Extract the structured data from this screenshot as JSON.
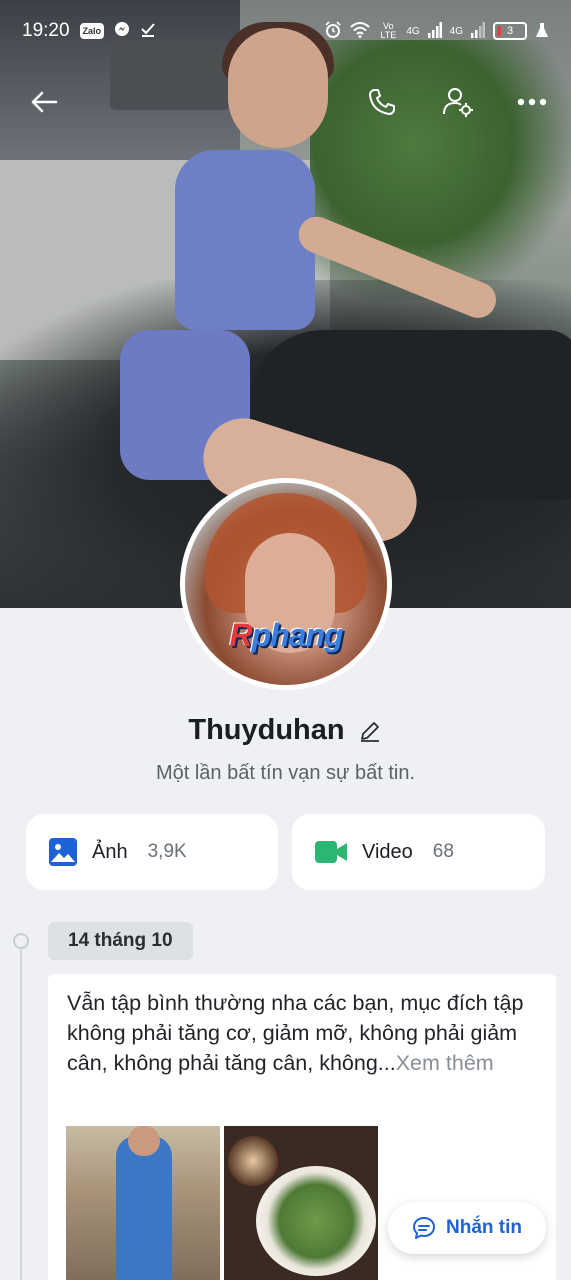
{
  "status_bar": {
    "time": "19:20",
    "network_label_1": "Vo LTE",
    "network_label_2": "4G",
    "network_label_3": "4G",
    "battery_level": "3",
    "notification_icons": [
      "zalo-icon",
      "messenger-icon",
      "check-icon"
    ],
    "system_icons": [
      "alarm-icon",
      "wifi-icon",
      "signal-icon",
      "signal-icon",
      "battery-icon",
      "flask-icon"
    ]
  },
  "nav": {
    "icons": [
      "back-arrow-icon",
      "phone-icon",
      "user-settings-icon",
      "more-dots-icon"
    ]
  },
  "profile": {
    "name": "Thuyduhan",
    "bio": "Một lần bất tín vạn sự bất tin.",
    "avatar_watermark_red": "R",
    "avatar_watermark_blue": "phang"
  },
  "media": {
    "photos_label": "Ảnh",
    "photos_count": "3,9K",
    "video_label": "Video",
    "video_count": "68"
  },
  "colors": {
    "photos_icon": "#1e63d6",
    "video_icon": "#2bb673",
    "accent": "#1e63d6",
    "background": "#eef0f4"
  },
  "timeline": {
    "date": "14 tháng 10",
    "post_text": "Vẫn tập bình thường nha các bạn, mục đích tập không phải tăng cơ, giảm mỡ, không phải giảm cân, không phải tăng cân, không...",
    "see_more": "Xem thêm"
  },
  "message_button": {
    "label": "Nhắn tin"
  }
}
